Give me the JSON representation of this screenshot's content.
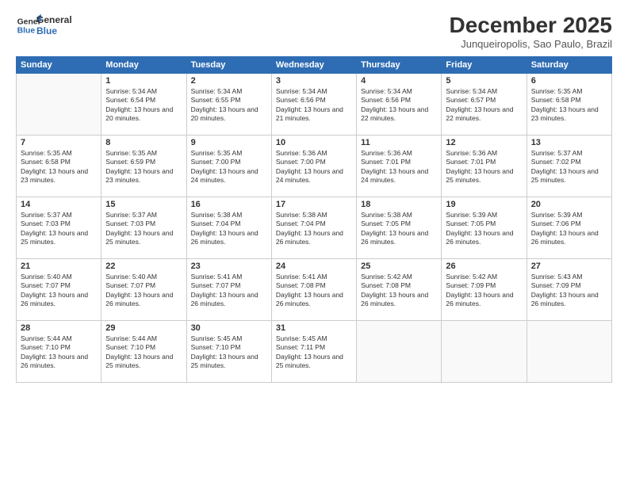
{
  "logo": {
    "line1": "General",
    "line2": "Blue"
  },
  "title": "December 2025",
  "location": "Junqueiropolis, Sao Paulo, Brazil",
  "days_of_week": [
    "Sunday",
    "Monday",
    "Tuesday",
    "Wednesday",
    "Thursday",
    "Friday",
    "Saturday"
  ],
  "weeks": [
    [
      {
        "day": "",
        "sunrise": "",
        "sunset": "",
        "daylight": ""
      },
      {
        "day": "1",
        "sunrise": "Sunrise: 5:34 AM",
        "sunset": "Sunset: 6:54 PM",
        "daylight": "Daylight: 13 hours and 20 minutes."
      },
      {
        "day": "2",
        "sunrise": "Sunrise: 5:34 AM",
        "sunset": "Sunset: 6:55 PM",
        "daylight": "Daylight: 13 hours and 20 minutes."
      },
      {
        "day": "3",
        "sunrise": "Sunrise: 5:34 AM",
        "sunset": "Sunset: 6:56 PM",
        "daylight": "Daylight: 13 hours and 21 minutes."
      },
      {
        "day": "4",
        "sunrise": "Sunrise: 5:34 AM",
        "sunset": "Sunset: 6:56 PM",
        "daylight": "Daylight: 13 hours and 22 minutes."
      },
      {
        "day": "5",
        "sunrise": "Sunrise: 5:34 AM",
        "sunset": "Sunset: 6:57 PM",
        "daylight": "Daylight: 13 hours and 22 minutes."
      },
      {
        "day": "6",
        "sunrise": "Sunrise: 5:35 AM",
        "sunset": "Sunset: 6:58 PM",
        "daylight": "Daylight: 13 hours and 23 minutes."
      }
    ],
    [
      {
        "day": "7",
        "sunrise": "Sunrise: 5:35 AM",
        "sunset": "Sunset: 6:58 PM",
        "daylight": "Daylight: 13 hours and 23 minutes."
      },
      {
        "day": "8",
        "sunrise": "Sunrise: 5:35 AM",
        "sunset": "Sunset: 6:59 PM",
        "daylight": "Daylight: 13 hours and 23 minutes."
      },
      {
        "day": "9",
        "sunrise": "Sunrise: 5:35 AM",
        "sunset": "Sunset: 7:00 PM",
        "daylight": "Daylight: 13 hours and 24 minutes."
      },
      {
        "day": "10",
        "sunrise": "Sunrise: 5:36 AM",
        "sunset": "Sunset: 7:00 PM",
        "daylight": "Daylight: 13 hours and 24 minutes."
      },
      {
        "day": "11",
        "sunrise": "Sunrise: 5:36 AM",
        "sunset": "Sunset: 7:01 PM",
        "daylight": "Daylight: 13 hours and 24 minutes."
      },
      {
        "day": "12",
        "sunrise": "Sunrise: 5:36 AM",
        "sunset": "Sunset: 7:01 PM",
        "daylight": "Daylight: 13 hours and 25 minutes."
      },
      {
        "day": "13",
        "sunrise": "Sunrise: 5:37 AM",
        "sunset": "Sunset: 7:02 PM",
        "daylight": "Daylight: 13 hours and 25 minutes."
      }
    ],
    [
      {
        "day": "14",
        "sunrise": "Sunrise: 5:37 AM",
        "sunset": "Sunset: 7:03 PM",
        "daylight": "Daylight: 13 hours and 25 minutes."
      },
      {
        "day": "15",
        "sunrise": "Sunrise: 5:37 AM",
        "sunset": "Sunset: 7:03 PM",
        "daylight": "Daylight: 13 hours and 25 minutes."
      },
      {
        "day": "16",
        "sunrise": "Sunrise: 5:38 AM",
        "sunset": "Sunset: 7:04 PM",
        "daylight": "Daylight: 13 hours and 26 minutes."
      },
      {
        "day": "17",
        "sunrise": "Sunrise: 5:38 AM",
        "sunset": "Sunset: 7:04 PM",
        "daylight": "Daylight: 13 hours and 26 minutes."
      },
      {
        "day": "18",
        "sunrise": "Sunrise: 5:38 AM",
        "sunset": "Sunset: 7:05 PM",
        "daylight": "Daylight: 13 hours and 26 minutes."
      },
      {
        "day": "19",
        "sunrise": "Sunrise: 5:39 AM",
        "sunset": "Sunset: 7:05 PM",
        "daylight": "Daylight: 13 hours and 26 minutes."
      },
      {
        "day": "20",
        "sunrise": "Sunrise: 5:39 AM",
        "sunset": "Sunset: 7:06 PM",
        "daylight": "Daylight: 13 hours and 26 minutes."
      }
    ],
    [
      {
        "day": "21",
        "sunrise": "Sunrise: 5:40 AM",
        "sunset": "Sunset: 7:07 PM",
        "daylight": "Daylight: 13 hours and 26 minutes."
      },
      {
        "day": "22",
        "sunrise": "Sunrise: 5:40 AM",
        "sunset": "Sunset: 7:07 PM",
        "daylight": "Daylight: 13 hours and 26 minutes."
      },
      {
        "day": "23",
        "sunrise": "Sunrise: 5:41 AM",
        "sunset": "Sunset: 7:07 PM",
        "daylight": "Daylight: 13 hours and 26 minutes."
      },
      {
        "day": "24",
        "sunrise": "Sunrise: 5:41 AM",
        "sunset": "Sunset: 7:08 PM",
        "daylight": "Daylight: 13 hours and 26 minutes."
      },
      {
        "day": "25",
        "sunrise": "Sunrise: 5:42 AM",
        "sunset": "Sunset: 7:08 PM",
        "daylight": "Daylight: 13 hours and 26 minutes."
      },
      {
        "day": "26",
        "sunrise": "Sunrise: 5:42 AM",
        "sunset": "Sunset: 7:09 PM",
        "daylight": "Daylight: 13 hours and 26 minutes."
      },
      {
        "day": "27",
        "sunrise": "Sunrise: 5:43 AM",
        "sunset": "Sunset: 7:09 PM",
        "daylight": "Daylight: 13 hours and 26 minutes."
      }
    ],
    [
      {
        "day": "28",
        "sunrise": "Sunrise: 5:44 AM",
        "sunset": "Sunset: 7:10 PM",
        "daylight": "Daylight: 13 hours and 26 minutes."
      },
      {
        "day": "29",
        "sunrise": "Sunrise: 5:44 AM",
        "sunset": "Sunset: 7:10 PM",
        "daylight": "Daylight: 13 hours and 25 minutes."
      },
      {
        "day": "30",
        "sunrise": "Sunrise: 5:45 AM",
        "sunset": "Sunset: 7:10 PM",
        "daylight": "Daylight: 13 hours and 25 minutes."
      },
      {
        "day": "31",
        "sunrise": "Sunrise: 5:45 AM",
        "sunset": "Sunset: 7:11 PM",
        "daylight": "Daylight: 13 hours and 25 minutes."
      },
      {
        "day": "",
        "sunrise": "",
        "sunset": "",
        "daylight": ""
      },
      {
        "day": "",
        "sunrise": "",
        "sunset": "",
        "daylight": ""
      },
      {
        "day": "",
        "sunrise": "",
        "sunset": "",
        "daylight": ""
      }
    ]
  ]
}
